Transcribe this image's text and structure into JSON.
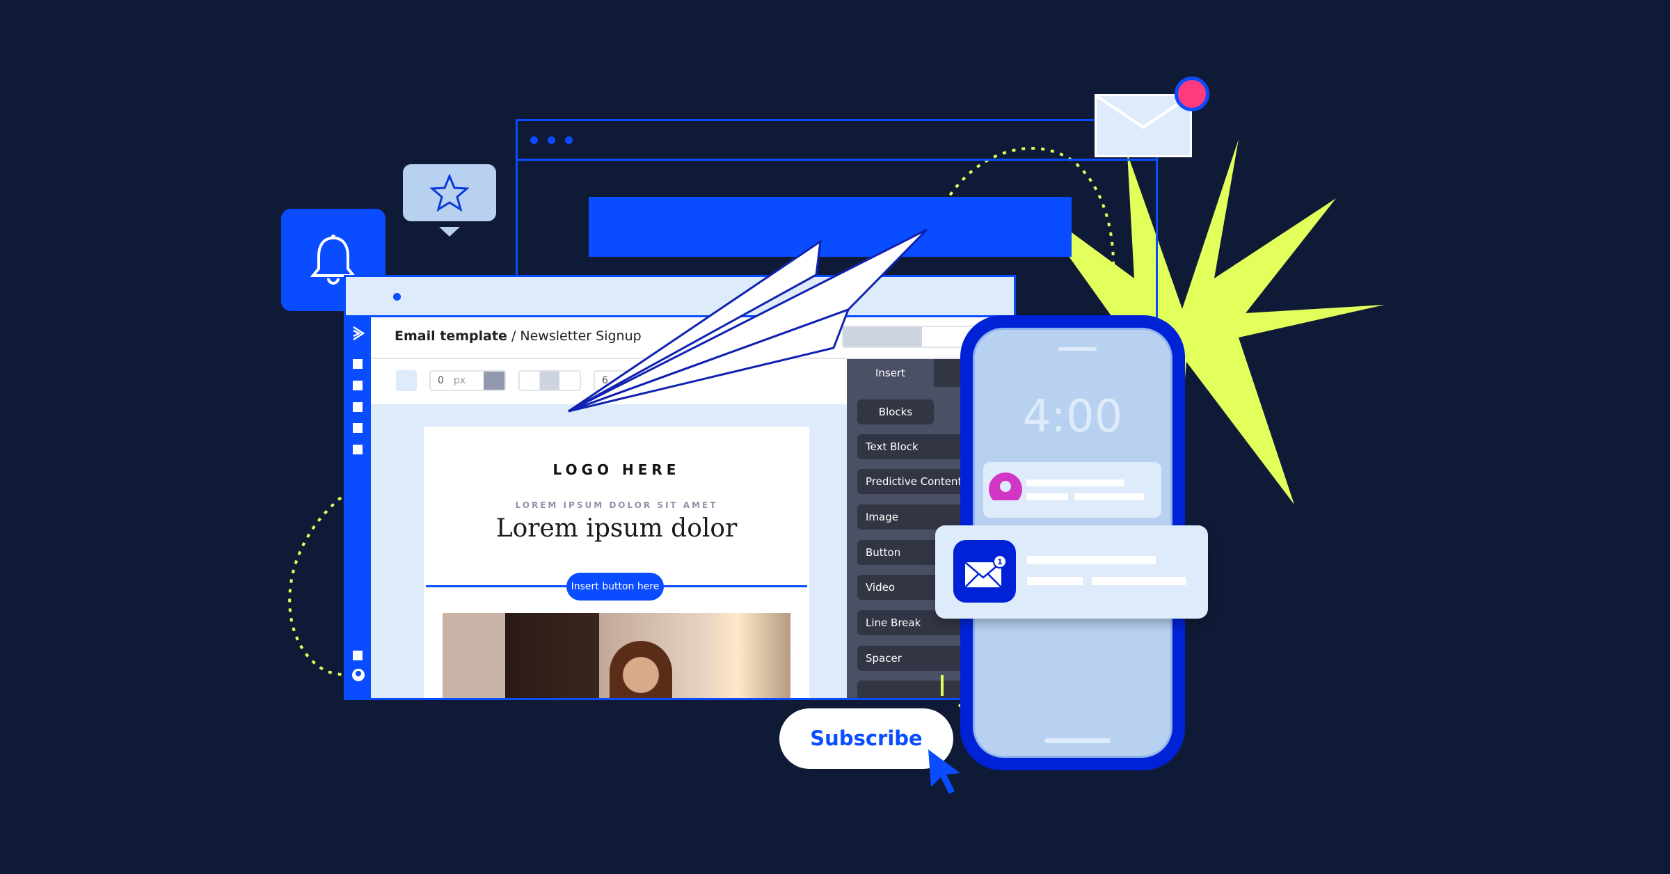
{
  "colors": {
    "background": "#0f1b36",
    "brand_blue": "#0a4cff",
    "phone_blue": "#0022d6",
    "accent_lime": "#e2ff5c",
    "notification_pink": "#ff3a7d"
  },
  "editor": {
    "breadcrumb_bold": "Email template",
    "breadcrumb_rest": " / Newsletter Signup",
    "padding_value": "0",
    "padding_unit": "px",
    "width_partial": "6"
  },
  "email": {
    "logo": "LOGO HERE",
    "eyebrow": "LOREM IPSUM DOLOR SIT AMET",
    "headline": "Lorem ipsum dolor",
    "button": "Insert button here"
  },
  "panel": {
    "tab": "Insert",
    "subtab": "Blocks",
    "items": [
      "Text Block",
      "Predictive Content",
      "Image",
      "Button",
      "Video",
      "Line Break",
      "Spacer"
    ]
  },
  "phone": {
    "time": "4:00",
    "badge_count": "1"
  },
  "cta": {
    "subscribe": "Subscribe"
  },
  "icons": [
    "bell-icon",
    "star-icon",
    "envelope-icon",
    "cursor-icon",
    "paper-plane-icon",
    "user-icon",
    "send-icon"
  ]
}
